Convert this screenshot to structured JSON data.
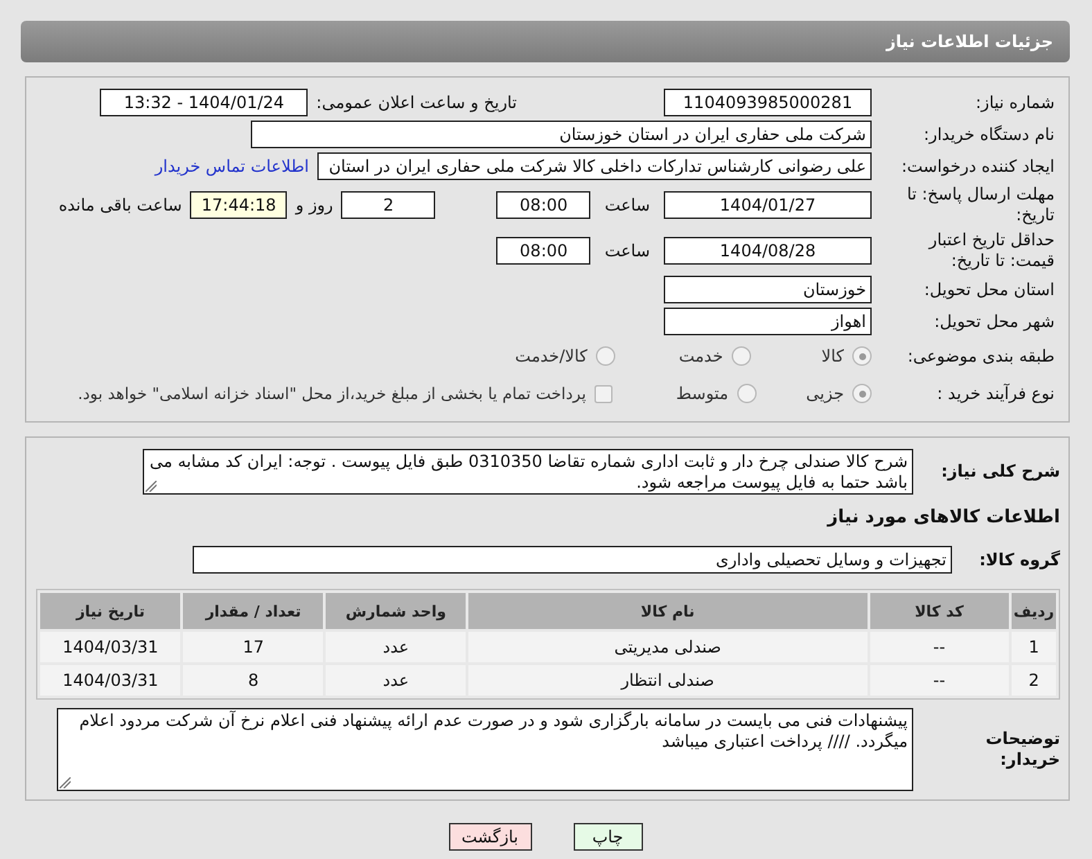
{
  "header": {
    "title": "جزئیات اطلاعات نیاز"
  },
  "details": [
    {
      "kind": "pair",
      "label": "شماره نیاز:",
      "value": "1104093985000281",
      "label_2": "تاریخ و ساعت اعلان عمومی:",
      "value_2": "1404/01/24 - 13:32"
    },
    {
      "kind": "wide",
      "label": "نام دستگاه خریدار:",
      "value": "شرکت ملی حفاری ایران در استان خوزستان"
    },
    {
      "kind": "creator",
      "label": "ایجاد کننده درخواست:",
      "value": "علی رضوانی کارشناس تدارکات داخلی  کالا شرکت ملی حفاری ایران در استان",
      "link": "اطلاعات تماس خریدار"
    },
    {
      "kind": "deadline",
      "label": "مهلت ارسال پاسخ: تا تاریخ:",
      "date": "1404/01/27",
      "time_label": "ساعت",
      "time": "08:00",
      "days": "2",
      "days_label": "روز و",
      "remaining": "17:44:18",
      "remaining_label": "ساعت باقی مانده"
    },
    {
      "kind": "validity",
      "label": "حداقل تاریخ اعتبار قیمت: تا تاریخ:",
      "date": "1404/08/28",
      "time_label": "ساعت",
      "time": "08:00"
    },
    {
      "kind": "field",
      "label": "استان محل تحویل:",
      "value": "خوزستان"
    },
    {
      "kind": "field",
      "label": "شهر محل تحویل:",
      "value": "اهواز"
    },
    {
      "kind": "radios",
      "label": "طبقه بندی موضوعی:",
      "options": [
        {
          "label": "کالا",
          "selected": true
        },
        {
          "label": "خدمت",
          "selected": false
        },
        {
          "label": "کالا/خدمت",
          "selected": false
        }
      ]
    },
    {
      "kind": "process",
      "label": "نوع فرآیند خرید :",
      "options": [
        {
          "label": "جزیی",
          "selected": true
        },
        {
          "label": "متوسط",
          "selected": false
        }
      ],
      "checkbox": {
        "label": "پرداخت تمام یا بخشی از مبلغ خرید،از محل \"اسناد خزانه اسلامی\" خواهد بود.",
        "checked": false
      }
    }
  ],
  "summary": {
    "label": "شرح کلی نیاز:",
    "value": "شرح کالا صندلی چرخ دار و ثابت اداری شماره تقاضا 0310350 طبق فایل پیوست . توجه: ایران کد مشابه می باشد حتما به فایل پیوست مراجعه شود."
  },
  "goods": {
    "title": "اطلاعات کالاهای مورد نیاز",
    "group_label": "گروه کالا:",
    "group": "تجهیزات و وسایل تحصیلی واداری",
    "columns": [
      "ردیف",
      "کد کالا",
      "نام کالا",
      "واحد شمارش",
      "تعداد / مقدار",
      "تاریخ نیاز"
    ],
    "rows": [
      [
        "1",
        "--",
        "صندلی مدیریتی",
        "عدد",
        "17",
        "1404/03/31"
      ],
      [
        "2",
        "--",
        "صندلی انتظار",
        "عدد",
        "8",
        "1404/03/31"
      ]
    ]
  },
  "buyer_notes": {
    "label": "توضیحات خریدار:",
    "value": "پیشنهادات فنی می بایست در سامانه بارگزاری شود و در صورت عدم ارائه پیشنهاد فنی اعلام نرخ آن شرکت مردود اعلام میگردد.  //// پرداخت اعتباری میباشد"
  },
  "buttons": [
    {
      "kind": "print",
      "label": "چاپ"
    },
    {
      "kind": "back",
      "label": "بازگشت"
    }
  ]
}
